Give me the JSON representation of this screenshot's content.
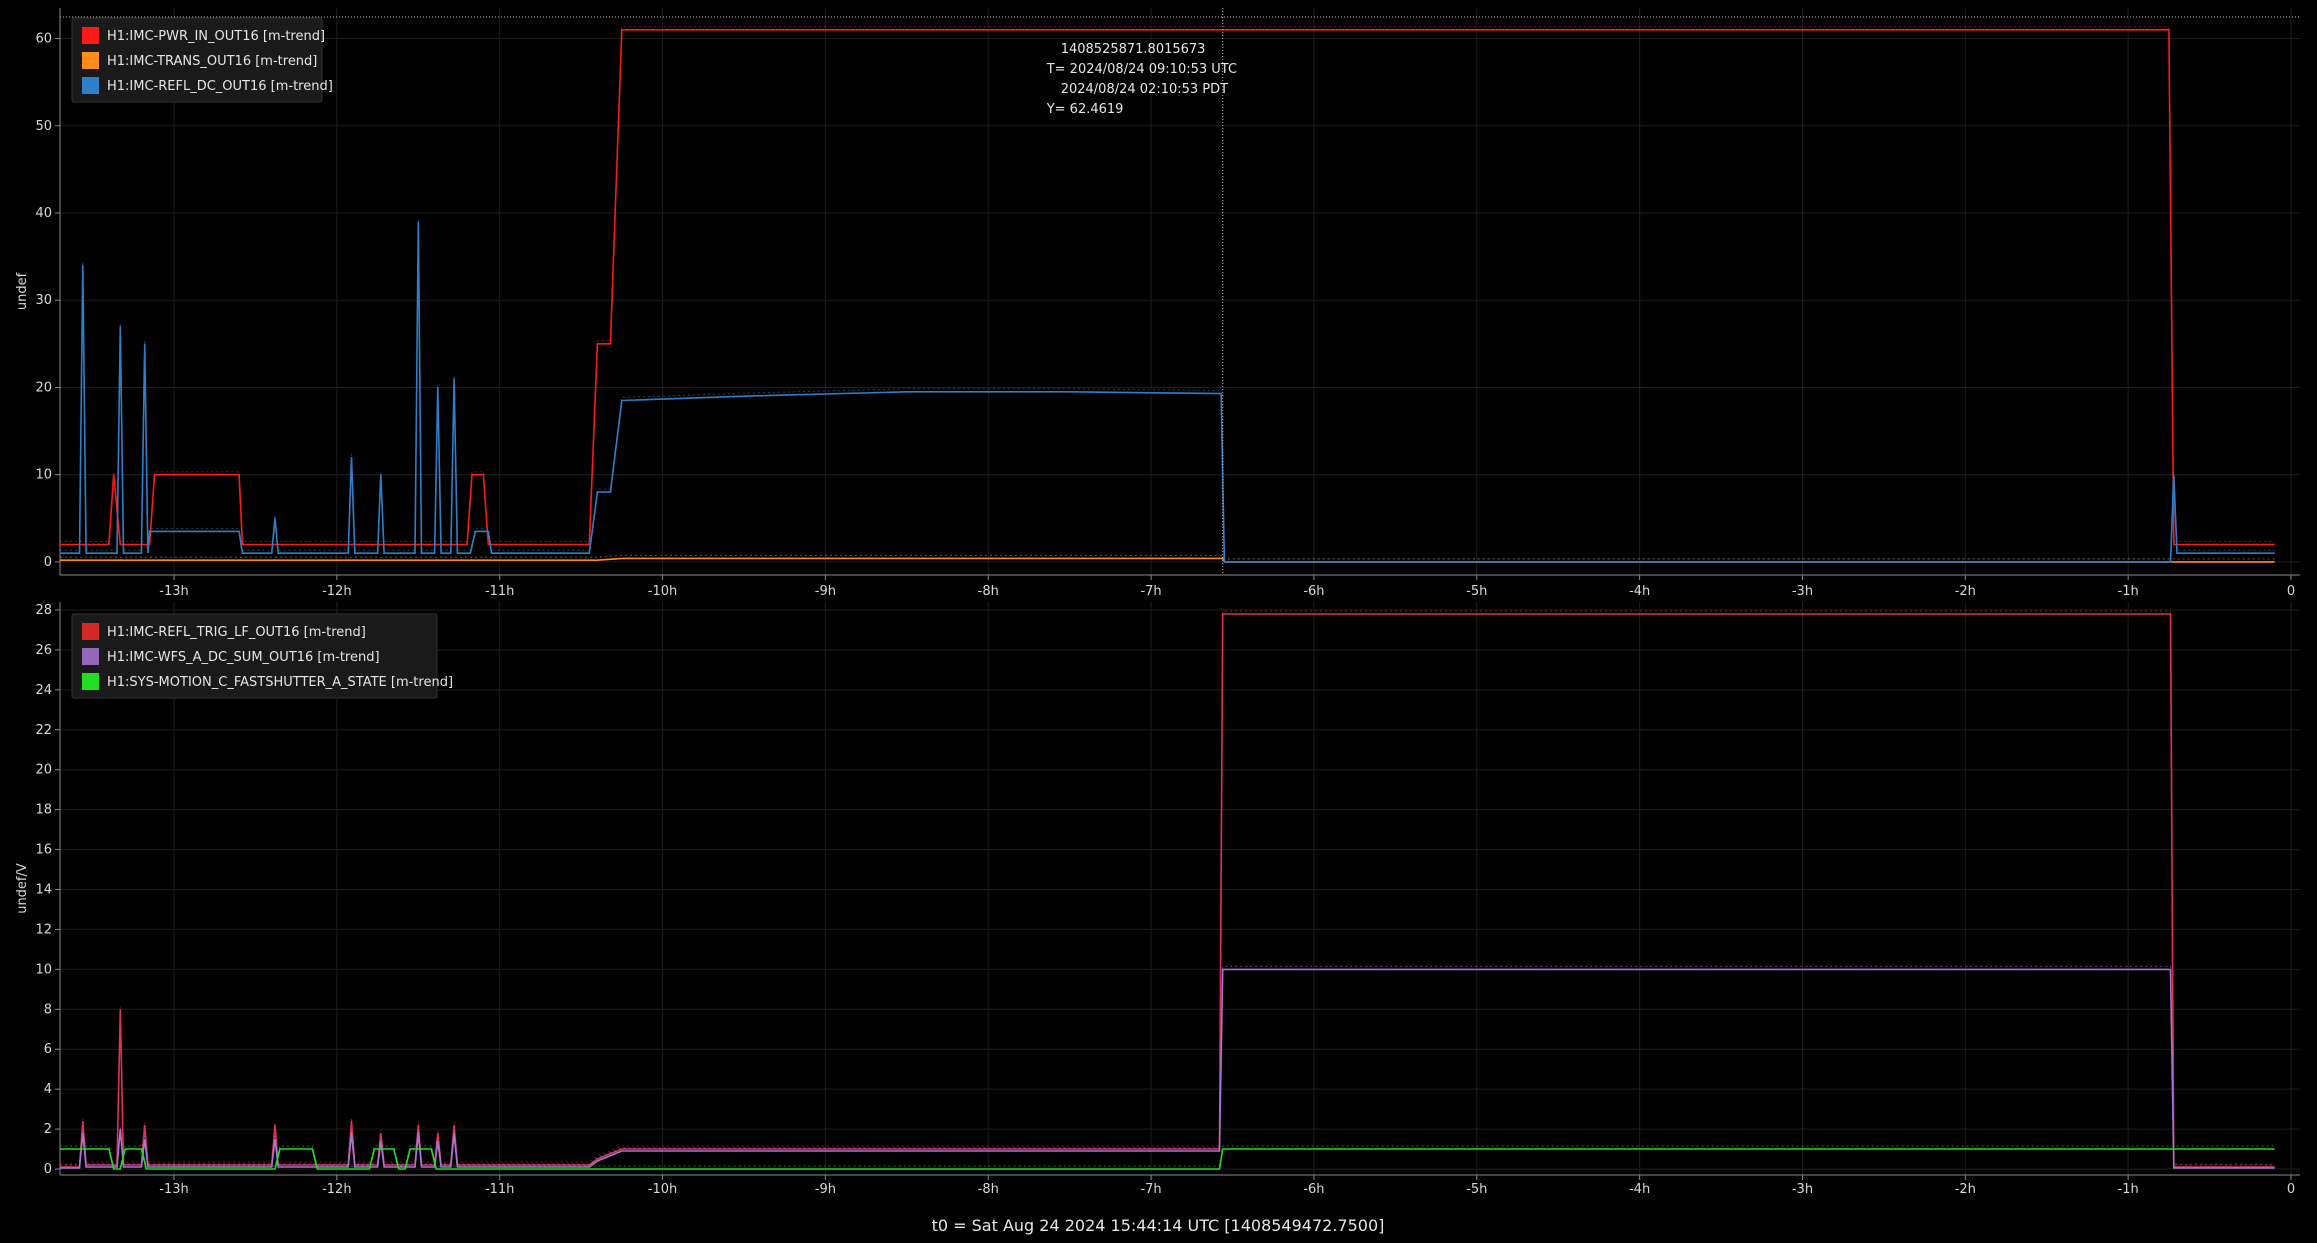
{
  "chart_data": [
    {
      "type": "line",
      "ylabel": "undef",
      "xlim": [
        -13.7,
        0
      ],
      "ylim": [
        -1.5,
        63.5
      ],
      "x_ticks": [
        -13,
        -12,
        -11,
        -10,
        -9,
        -8,
        -7,
        -6,
        -5,
        -4,
        -3,
        -2,
        -1,
        0
      ],
      "x_tick_labels": [
        "-13h",
        "-12h",
        "-11h",
        "-10h",
        "-9h",
        "-8h",
        "-7h",
        "-6h",
        "-5h",
        "-4h",
        "-3h",
        "-2h",
        "-1h",
        "0"
      ],
      "y_ticks": [
        0,
        10,
        20,
        30,
        40,
        50,
        60
      ],
      "y_tick_labels": [
        "0",
        "10",
        "20",
        "30",
        "40",
        "50",
        "60"
      ],
      "grid": true,
      "legend_position": "top-left",
      "legend": [
        {
          "name": "H1:IMC-PWR_IN_OUT16 [m-trend]",
          "color": "#ff1a1a"
        },
        {
          "name": "H1:IMC-TRANS_OUT16 [m-trend]",
          "color": "#ff8c1a"
        },
        {
          "name": "H1:IMC-REFL_DC_OUT16 [m-trend]",
          "color": "#2f7fc8"
        }
      ],
      "cursor": {
        "x": -6.56,
        "y": 62.4619,
        "gps": "1408525871.8015673",
        "utc": "T= 2024/08/24 09:10:53 UTC",
        "pdt": "2024/08/24 02:10:53 PDT",
        "yvalue": "Y= 62.4619"
      },
      "series": [
        {
          "name": "H1:IMC-PWR_IN_OUT16 [m-trend]",
          "color": "#ff1a1a",
          "points": [
            [
              -13.7,
              2
            ],
            [
              -13.4,
              2
            ],
            [
              -13.37,
              10
            ],
            [
              -13.33,
              2
            ],
            [
              -13.15,
              2
            ],
            [
              -13.12,
              10
            ],
            [
              -12.6,
              10
            ],
            [
              -12.58,
              2
            ],
            [
              -11.2,
              2
            ],
            [
              -11.17,
              10
            ],
            [
              -11.1,
              10
            ],
            [
              -11.07,
              2
            ],
            [
              -10.45,
              2
            ],
            [
              -10.4,
              25
            ],
            [
              -10.32,
              25
            ],
            [
              -10.25,
              61
            ],
            [
              -6.56,
              61
            ],
            [
              -0.75,
              61
            ],
            [
              -0.72,
              2
            ],
            [
              -0.1,
              2
            ]
          ]
        },
        {
          "name": "H1:IMC-TRANS_OUT16 [m-trend]",
          "color": "#ff8c1a",
          "points": [
            [
              -13.7,
              0.2
            ],
            [
              -10.4,
              0.2
            ],
            [
              -10.25,
              0.4
            ],
            [
              -6.56,
              0.4
            ],
            [
              -6.55,
              0
            ],
            [
              -0.72,
              0
            ],
            [
              -0.1,
              0
            ]
          ]
        },
        {
          "name": "H1:IMC-REFL_DC_OUT16 [m-trend]",
          "color": "#2f7fc8",
          "points": [
            [
              -13.7,
              1
            ],
            [
              -13.58,
              1
            ],
            [
              -13.56,
              34
            ],
            [
              -13.54,
              1
            ],
            [
              -13.35,
              1
            ],
            [
              -13.33,
              27
            ],
            [
              -13.31,
              1
            ],
            [
              -13.2,
              1
            ],
            [
              -13.18,
              25
            ],
            [
              -13.16,
              1
            ],
            [
              -13.15,
              3.5
            ],
            [
              -12.6,
              3.5
            ],
            [
              -12.58,
              1
            ],
            [
              -12.4,
              1
            ],
            [
              -12.38,
              5
            ],
            [
              -12.36,
              1
            ],
            [
              -11.93,
              1
            ],
            [
              -11.91,
              12
            ],
            [
              -11.89,
              1
            ],
            [
              -11.75,
              1
            ],
            [
              -11.73,
              10
            ],
            [
              -11.71,
              1
            ],
            [
              -11.52,
              1
            ],
            [
              -11.5,
              39
            ],
            [
              -11.48,
              1
            ],
            [
              -11.4,
              1
            ],
            [
              -11.38,
              20
            ],
            [
              -11.36,
              1
            ],
            [
              -11.3,
              1
            ],
            [
              -11.28,
              21
            ],
            [
              -11.26,
              1
            ],
            [
              -11.18,
              1
            ],
            [
              -11.15,
              3.5
            ],
            [
              -11.07,
              3.5
            ],
            [
              -11.05,
              1
            ],
            [
              -10.45,
              1
            ],
            [
              -10.4,
              8
            ],
            [
              -10.32,
              8
            ],
            [
              -10.25,
              18.5
            ],
            [
              -9.5,
              19
            ],
            [
              -8.5,
              19.5
            ],
            [
              -7.5,
              19.5
            ],
            [
              -6.57,
              19.3
            ],
            [
              -6.55,
              0
            ],
            [
              -0.74,
              0
            ],
            [
              -0.72,
              10
            ],
            [
              -0.7,
              1
            ],
            [
              -0.1,
              1
            ]
          ]
        }
      ]
    },
    {
      "type": "line",
      "ylabel": "undef/V",
      "xlim": [
        -13.7,
        0
      ],
      "ylim": [
        -0.3,
        28.4
      ],
      "x_ticks": [
        -13,
        -12,
        -11,
        -10,
        -9,
        -8,
        -7,
        -6,
        -5,
        -4,
        -3,
        -2,
        -1,
        0
      ],
      "x_tick_labels": [
        "-13h",
        "-12h",
        "-11h",
        "-10h",
        "-9h",
        "-8h",
        "-7h",
        "-6h",
        "-5h",
        "-4h",
        "-3h",
        "-2h",
        "-1h",
        "0"
      ],
      "y_ticks": [
        0,
        2,
        4,
        6,
        8,
        10,
        12,
        14,
        16,
        18,
        20,
        22,
        24,
        26,
        28
      ],
      "y_tick_labels": [
        "0",
        "2",
        "4",
        "6",
        "8",
        "10",
        "12",
        "14",
        "16",
        "18",
        "20",
        "22",
        "24",
        "26",
        "28"
      ],
      "grid": true,
      "legend_position": "top-left",
      "legend": [
        {
          "name": "H1:IMC-REFL_TRIG_LF_OUT16 [m-trend]",
          "color": "#d62728"
        },
        {
          "name": "H1:IMC-WFS_A_DC_SUM_OUT16 [m-trend]",
          "color": "#9467bd"
        },
        {
          "name": "H1:SYS-MOTION_C_FASTSHUTTER_A_STATE [m-trend]",
          "color": "#22dd22"
        }
      ],
      "series": [
        {
          "name": "H1:IMC-REFL_TRIG_LF_OUT16 [m-trend]",
          "color": "#e0305a",
          "points": [
            [
              -13.7,
              0.1
            ],
            [
              -13.58,
              0.1
            ],
            [
              -13.56,
              2.4
            ],
            [
              -13.54,
              0.2
            ],
            [
              -13.35,
              0.2
            ],
            [
              -13.33,
              8
            ],
            [
              -13.31,
              0.2
            ],
            [
              -13.2,
              0.2
            ],
            [
              -13.18,
              2.2
            ],
            [
              -13.16,
              0.2
            ],
            [
              -12.4,
              0.2
            ],
            [
              -12.38,
              2.2
            ],
            [
              -12.36,
              0.2
            ],
            [
              -11.93,
              0.2
            ],
            [
              -11.91,
              2.4
            ],
            [
              -11.89,
              0.2
            ],
            [
              -11.75,
              0.2
            ],
            [
              -11.73,
              1.8
            ],
            [
              -11.71,
              0.2
            ],
            [
              -11.52,
              0.2
            ],
            [
              -11.5,
              2.2
            ],
            [
              -11.48,
              0.2
            ],
            [
              -11.4,
              0.2
            ],
            [
              -11.38,
              1.8
            ],
            [
              -11.36,
              0.2
            ],
            [
              -11.3,
              0.2
            ],
            [
              -11.28,
              2.2
            ],
            [
              -11.26,
              0.2
            ],
            [
              -10.45,
              0.2
            ],
            [
              -10.4,
              0.5
            ],
            [
              -10.25,
              1.0
            ],
            [
              -6.58,
              1.0
            ],
            [
              -6.56,
              27.8
            ],
            [
              -0.74,
              27.8
            ],
            [
              -0.72,
              0.1
            ],
            [
              -0.1,
              0.1
            ]
          ]
        },
        {
          "name": "H1:IMC-WFS_A_DC_SUM_OUT16 [m-trend]",
          "color": "#a377d6",
          "points": [
            [
              -13.7,
              0.05
            ],
            [
              -13.58,
              0.05
            ],
            [
              -13.56,
              1.8
            ],
            [
              -13.54,
              0.1
            ],
            [
              -13.35,
              0.1
            ],
            [
              -13.33,
              2
            ],
            [
              -13.31,
              0.1
            ],
            [
              -13.2,
              0.1
            ],
            [
              -13.18,
              1.5
            ],
            [
              -13.16,
              0.1
            ],
            [
              -12.4,
              0.1
            ],
            [
              -12.38,
              1.5
            ],
            [
              -12.36,
              0.1
            ],
            [
              -11.93,
              0.1
            ],
            [
              -11.91,
              1.8
            ],
            [
              -11.89,
              0.1
            ],
            [
              -11.75,
              0.1
            ],
            [
              -11.73,
              1.4
            ],
            [
              -11.71,
              0.1
            ],
            [
              -11.52,
              0.1
            ],
            [
              -11.5,
              1.8
            ],
            [
              -11.48,
              0.1
            ],
            [
              -11.4,
              0.1
            ],
            [
              -11.38,
              1.4
            ],
            [
              -11.36,
              0.1
            ],
            [
              -11.3,
              0.1
            ],
            [
              -11.28,
              1.8
            ],
            [
              -11.26,
              0.1
            ],
            [
              -10.45,
              0.1
            ],
            [
              -10.4,
              0.4
            ],
            [
              -10.25,
              0.9
            ],
            [
              -6.58,
              0.9
            ],
            [
              -6.56,
              10
            ],
            [
              -0.74,
              10
            ],
            [
              -0.72,
              0.05
            ],
            [
              -0.1,
              0.05
            ]
          ]
        },
        {
          "name": "H1:SYS-MOTION_C_FASTSHUTTER_A_STATE [m-trend]",
          "color": "#22dd22",
          "points": [
            [
              -13.7,
              1
            ],
            [
              -13.4,
              1
            ],
            [
              -13.37,
              0
            ],
            [
              -13.33,
              0
            ],
            [
              -13.3,
              1
            ],
            [
              -13.2,
              1
            ],
            [
              -13.17,
              0
            ],
            [
              -12.38,
              0
            ],
            [
              -12.35,
              1
            ],
            [
              -12.15,
              1
            ],
            [
              -12.12,
              0
            ],
            [
              -11.8,
              0
            ],
            [
              -11.77,
              1
            ],
            [
              -11.65,
              1
            ],
            [
              -11.62,
              0
            ],
            [
              -11.58,
              0
            ],
            [
              -11.55,
              1
            ],
            [
              -11.42,
              1
            ],
            [
              -11.39,
              0
            ],
            [
              -6.58,
              0
            ],
            [
              -6.56,
              1
            ],
            [
              -0.1,
              1
            ]
          ]
        }
      ]
    }
  ],
  "footer": {
    "text": "t0 = Sat Aug 24 2024 15:44:14 UTC [1408549472.7500]"
  }
}
